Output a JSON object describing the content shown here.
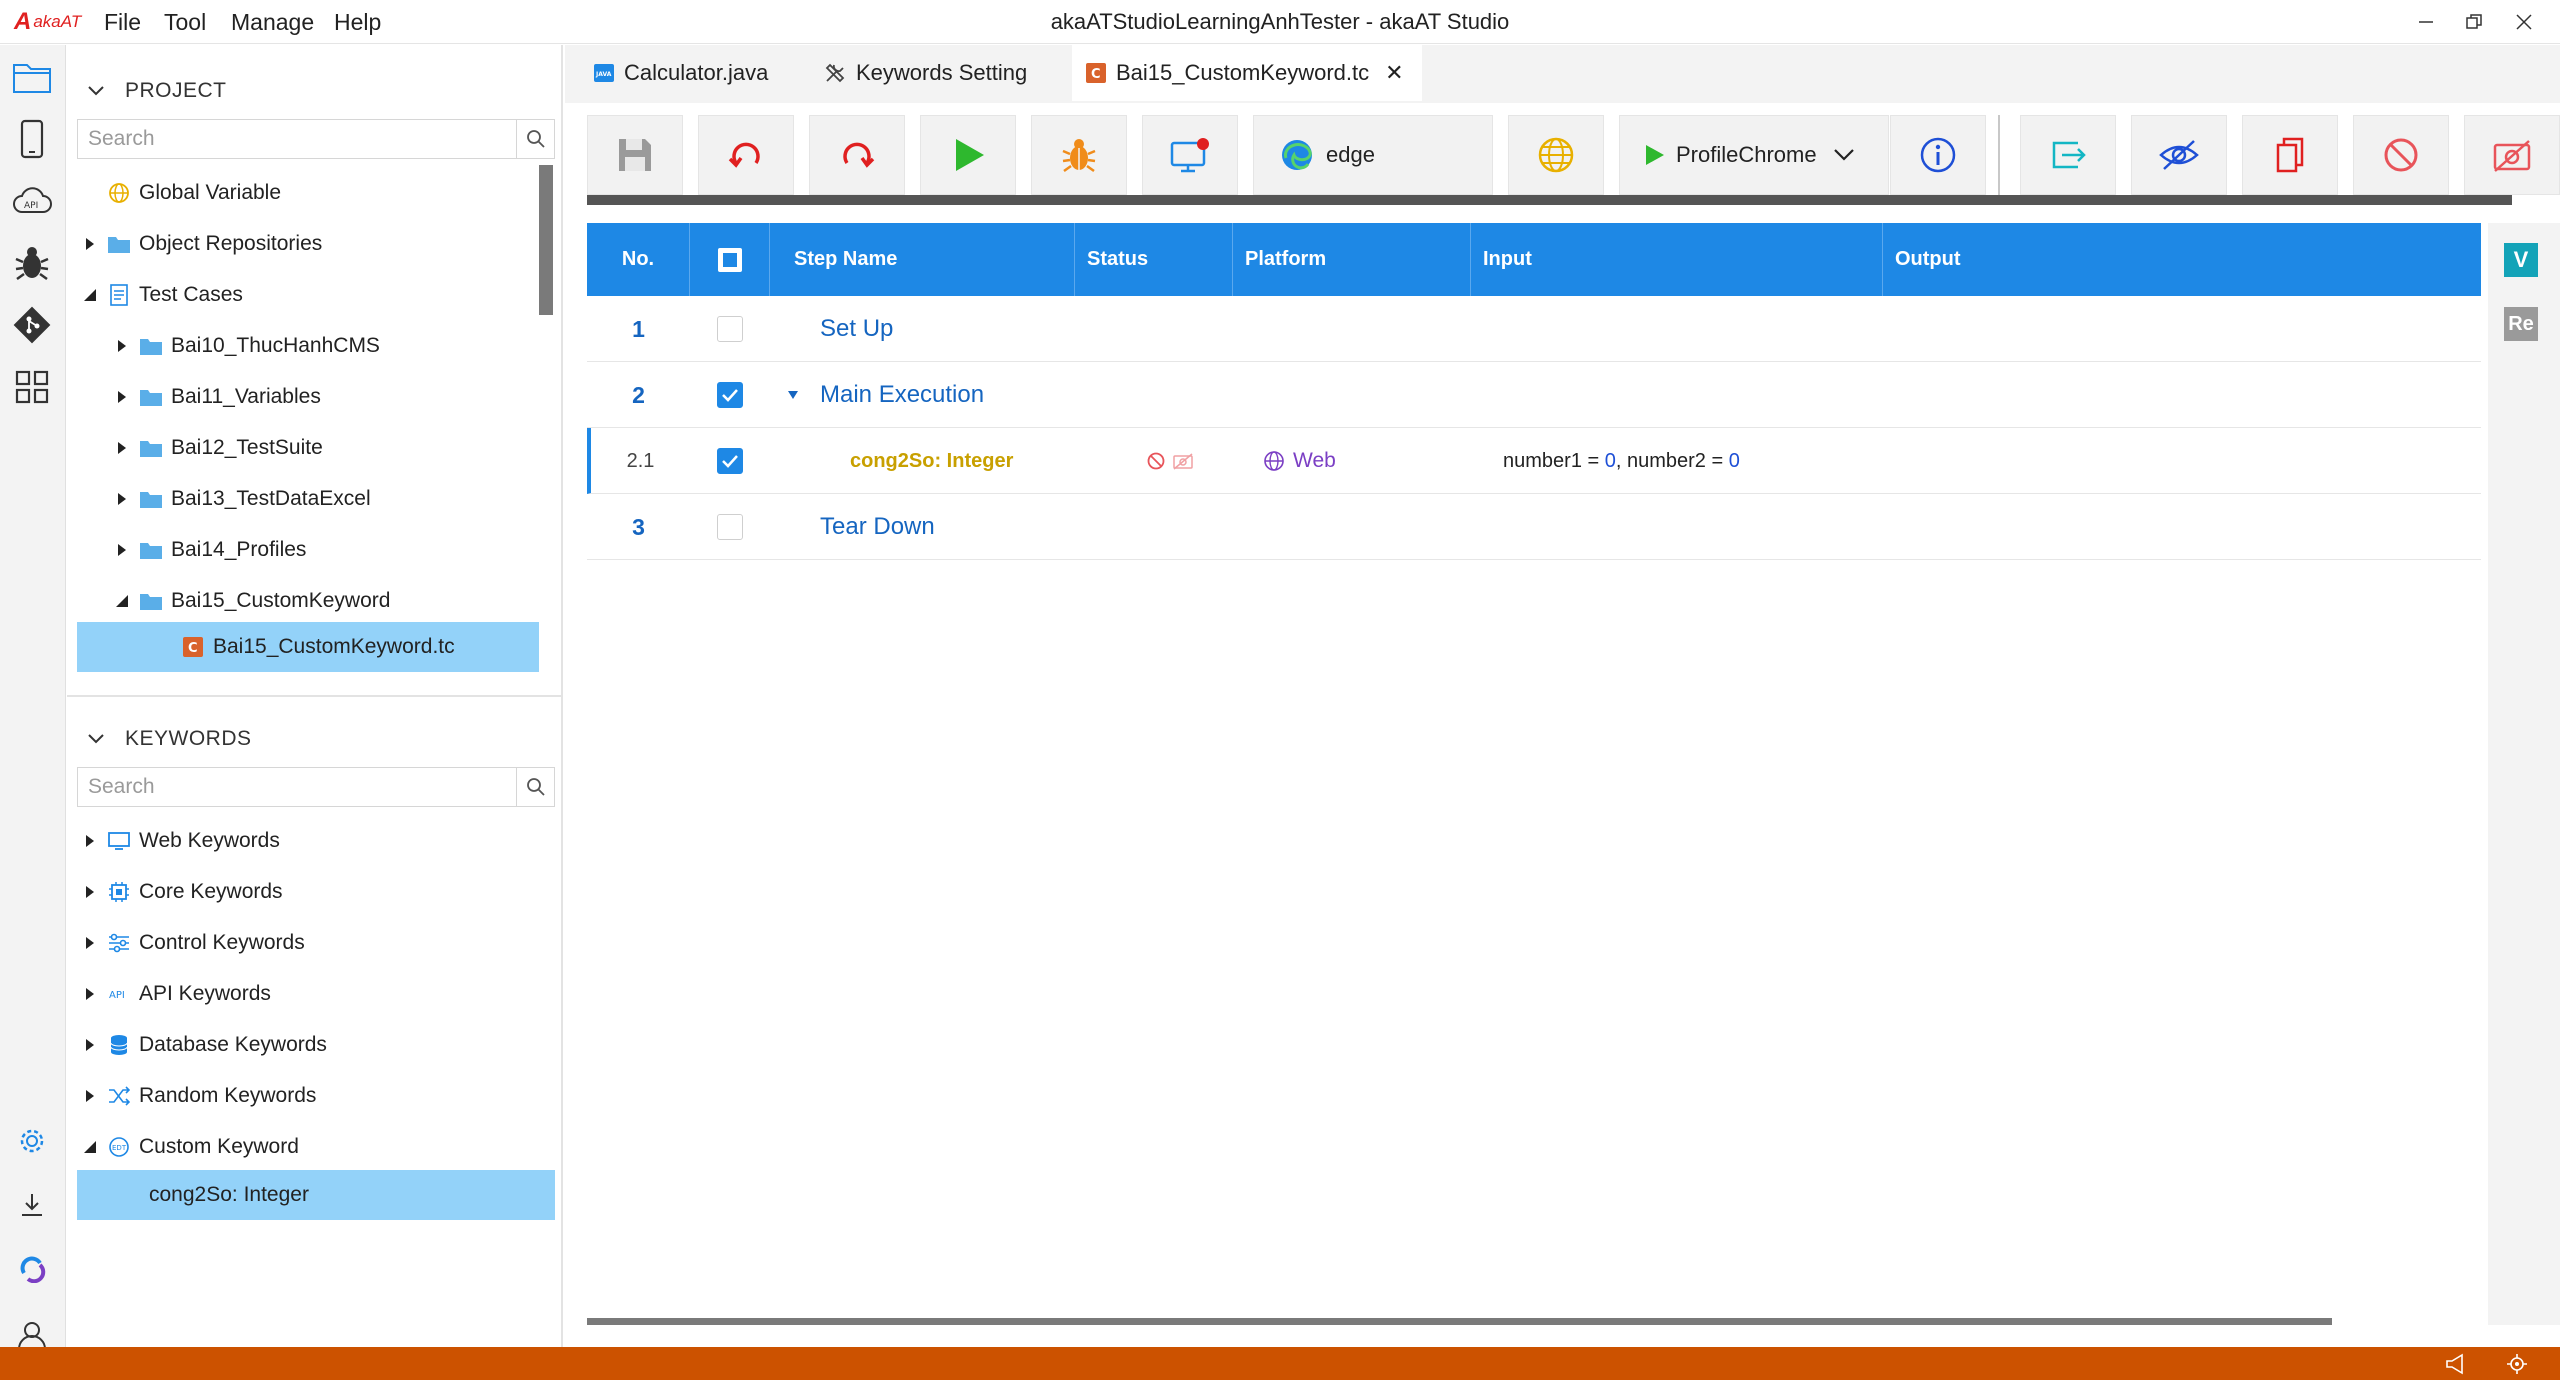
{
  "app": {
    "logo_letter": "A",
    "logo_text": "akaAT",
    "title": "akaATStudioLearningAnhTester - akaAT Studio",
    "menu": [
      "File",
      "Tool",
      "Manage",
      "Help"
    ]
  },
  "project": {
    "header": "PROJECT",
    "search_placeholder": "Search",
    "items": [
      {
        "label": "Global Variable",
        "icon": "globe-icon"
      },
      {
        "label": "Object Repositories",
        "icon": "folder-icon"
      },
      {
        "label": "Test Cases",
        "icon": "document-icon"
      },
      {
        "label": "Bai10_ThucHanhCMS",
        "icon": "folder-icon"
      },
      {
        "label": "Bai11_Variables",
        "icon": "folder-icon"
      },
      {
        "label": "Bai12_TestSuite",
        "icon": "folder-icon"
      },
      {
        "label": "Bai13_TestDataExcel",
        "icon": "folder-icon"
      },
      {
        "label": "Bai14_Profiles",
        "icon": "folder-icon"
      },
      {
        "label": "Bai15_CustomKeyword",
        "icon": "folder-icon"
      },
      {
        "label": "Bai15_CustomKeyword.tc",
        "icon": "testcase-icon"
      }
    ]
  },
  "keywords": {
    "header": "KEYWORDS",
    "search_placeholder": "Search",
    "items": [
      {
        "label": "Web Keywords",
        "icon": "monitor-icon"
      },
      {
        "label": "Core Keywords",
        "icon": "chip-icon"
      },
      {
        "label": "Control Keywords",
        "icon": "sliders-icon"
      },
      {
        "label": "API Keywords",
        "icon": "api-icon"
      },
      {
        "label": "Database Keywords",
        "icon": "database-icon"
      },
      {
        "label": "Random Keywords",
        "icon": "shuffle-icon"
      },
      {
        "label": "Custom Keyword",
        "icon": "custom-icon"
      },
      {
        "label": "cong2So: Integer",
        "icon": ""
      }
    ]
  },
  "tabs": [
    {
      "label": "Calculator.java",
      "icon": "java-icon"
    },
    {
      "label": "Keywords Setting",
      "icon": "tools-icon"
    },
    {
      "label": "Bai15_CustomKeyword.tc",
      "icon": "testcase-icon",
      "close": "✕"
    }
  ],
  "toolbar": {
    "browser": "edge",
    "profile": "ProfileChrome"
  },
  "table": {
    "headers": [
      "No.",
      "",
      "Step Name",
      "Status",
      "Platform",
      "Input",
      "Output"
    ],
    "rows": [
      {
        "no": "1",
        "checked": false,
        "name": "Set Up"
      },
      {
        "no": "2",
        "checked": true,
        "name": "Main Execution"
      },
      {
        "no": "2.1",
        "checked": true,
        "name": "cong2So: Integer",
        "platform": "Web",
        "input_k1": "number1",
        "input_v1": "0",
        "input_k2": "number2",
        "input_v2": "0"
      },
      {
        "no": "3",
        "checked": false,
        "name": "Tear Down"
      }
    ]
  },
  "right_strip": {
    "v_label": "V",
    "re_label": "Re"
  },
  "colors": {
    "accent": "#1e88e5",
    "status_bar": "#cc5200",
    "selection": "#93d2f9",
    "keyword_name": "#c8a000",
    "web": "#7b3fc4"
  }
}
